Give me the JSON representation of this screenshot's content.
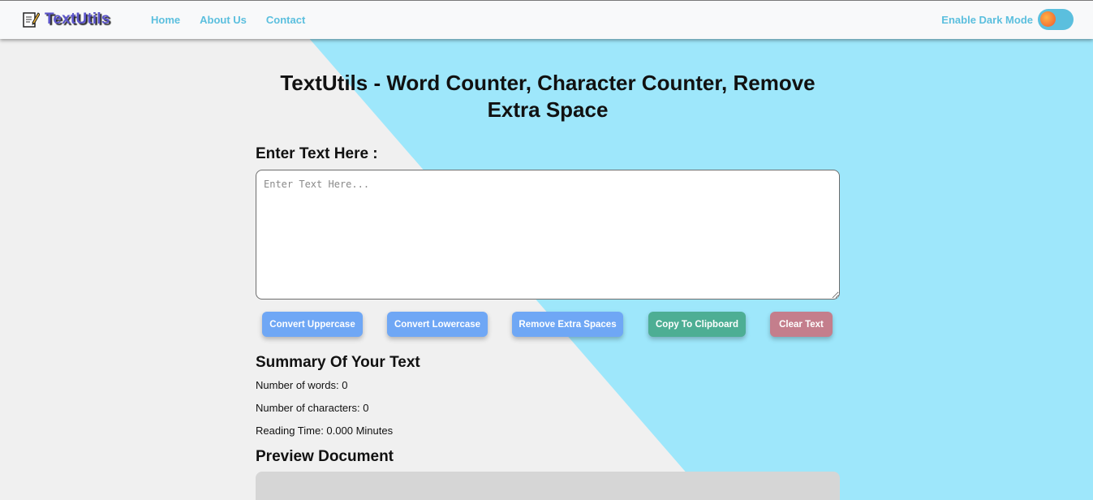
{
  "brand": {
    "name": "TextUtils",
    "icon": "memo-icon"
  },
  "nav": {
    "links": [
      "Home",
      "About Us",
      "Contact"
    ]
  },
  "dark_mode": {
    "label": "Enable Dark Mode",
    "enabled": false
  },
  "colors": {
    "accent": "#5bbfde",
    "brand": "#5b54c9",
    "background_light": "#f0f0f0",
    "background_diagonal": "#9ee7fb",
    "button_blue": "#6fa7f5",
    "button_green": "#4dae94",
    "button_red": "#c47e8c"
  },
  "main": {
    "title": "TextUtils - Word Counter, Character Counter, Remove Extra Space",
    "enter_label": "Enter Text Here :",
    "textarea": {
      "value": "",
      "placeholder": "Enter Text Here..."
    },
    "buttons": {
      "uppercase": "Convert Uppercase",
      "lowercase": "Convert Lowercase",
      "remove_spaces": "Remove Extra Spaces",
      "copy": "Copy To Clipboard",
      "clear": "Clear Text"
    },
    "summary": {
      "title": "Summary Of Your Text",
      "words": "Number of words: 0",
      "characters": "Number of characters: 0",
      "reading_time": "Reading Time: 0.000 Minutes"
    },
    "preview": {
      "title": "Preview Document",
      "content": ""
    }
  }
}
